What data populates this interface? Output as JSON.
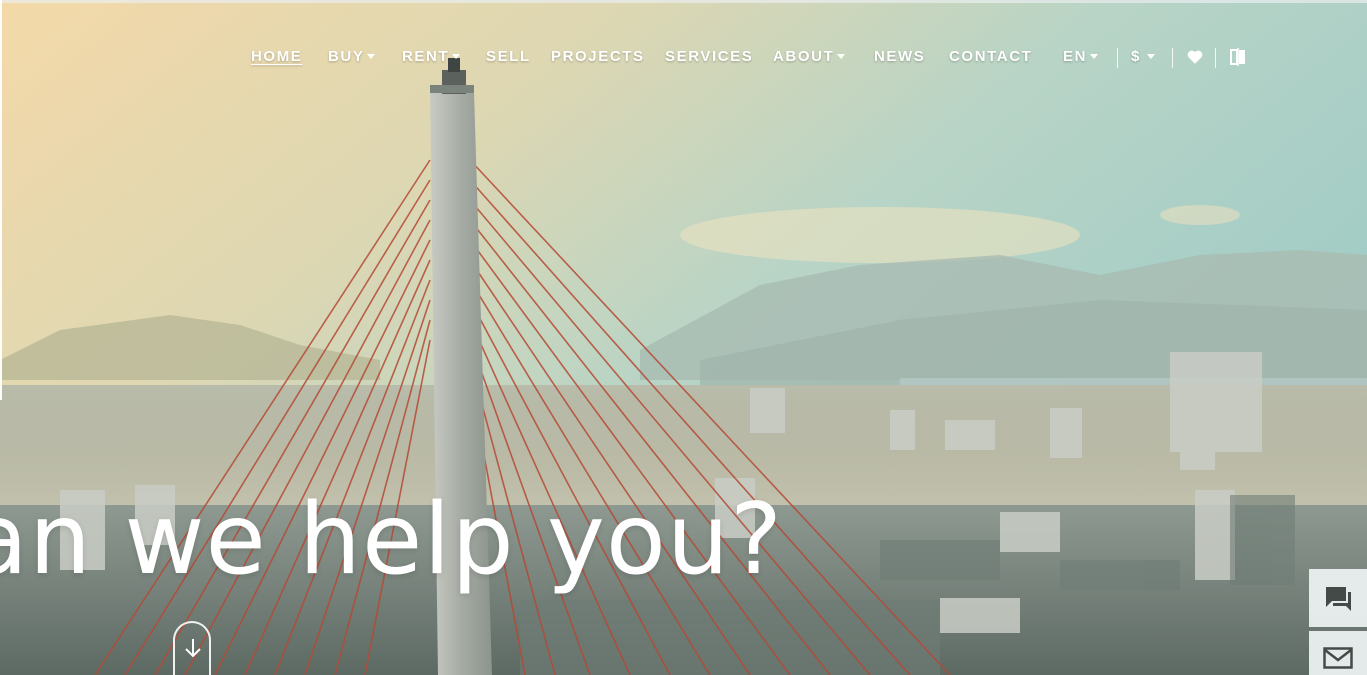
{
  "nav": {
    "home": "HOME",
    "buy": "BUY",
    "rent": "RENT",
    "sell": "SELL",
    "projects": "PROJECTS",
    "services": "SERVICES",
    "about": "ABOUT",
    "news": "NEWS",
    "contact": "CONTACT",
    "language": "EN",
    "currency": "$",
    "active": "HOME"
  },
  "hero": {
    "headline": "an we help you?"
  },
  "icons": {
    "wishlist": "heart-icon",
    "compare": "compare-icon",
    "chat": "chat-icon",
    "mail": "mail-icon",
    "scroll": "arrow-down-icon"
  },
  "colors": {
    "sky_top": "#a9cfc9",
    "sky_warm": "#f1d8ad",
    "city": "#7e8d88",
    "cable": "#b44a35",
    "nav_text": "#ffffff"
  }
}
